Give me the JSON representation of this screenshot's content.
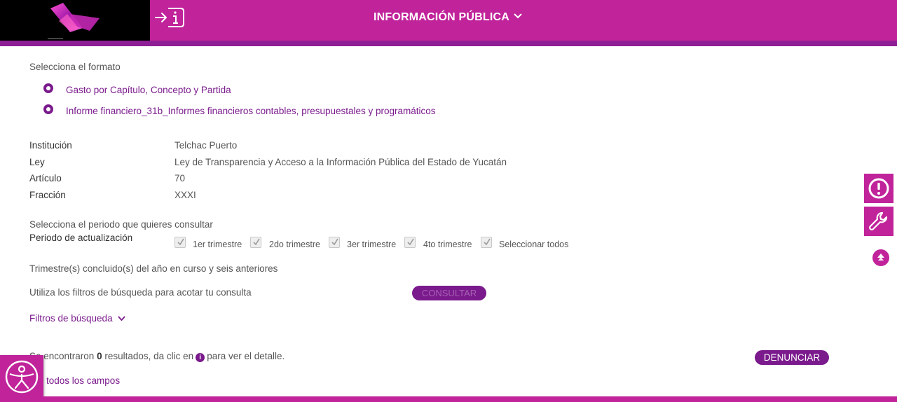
{
  "header": {
    "title": "INFORMACIÓN PÚBLICA",
    "colors": {
      "magenta": "#c0239a",
      "purple": "#8e1e95",
      "dark_purple": "#7a1a8c"
    }
  },
  "format": {
    "label": "Selecciona el formato",
    "options": [
      "Gasto por Capítulo, Concepto y Partida",
      "Informe financiero_31b_Informes financieros contables, presupuestales y programáticos"
    ]
  },
  "details": {
    "institucion_label": "Institución",
    "institucion_value": "Telchac Puerto",
    "ley_label": "Ley",
    "ley_value": "Ley de Transparencia y Acceso a la Información Pública del Estado de Yucatán",
    "articulo_label": "Artículo",
    "articulo_value": "70",
    "fraccion_label": "Fracción",
    "fraccion_value": "XXXI"
  },
  "period": {
    "prompt": "Selecciona el periodo que quieres consultar",
    "label": "Periodo de actualización",
    "options": [
      "1er trimestre",
      "2do trimestre",
      "3er trimestre",
      "4to trimestre",
      "Seleccionar todos"
    ],
    "note": "Trimestre(s) concluido(s) del año en curso y seis anteriores"
  },
  "filters": {
    "prompt": "Utiliza los filtros de búsqueda para acotar tu consulta",
    "consultar_label": "CONSULTAR",
    "toggle_label": "Filtros de búsqueda"
  },
  "results": {
    "prefix": "Se encontraron",
    "count": "0",
    "middle": "resultados, da clic en",
    "suffix": "para ver el detalle.",
    "denunciar_label": "DENUNCIAR",
    "campos_label": "Ver todos los campos"
  },
  "icons": {
    "login": "login-info-icon",
    "alert": "alert-icon",
    "wrench": "wrench-icon",
    "up": "scroll-up-icon",
    "accessibility": "accessibility-icon"
  }
}
